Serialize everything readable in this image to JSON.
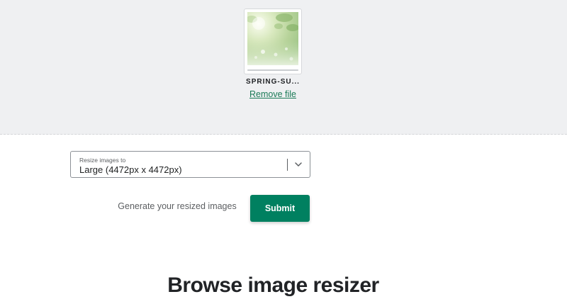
{
  "upload": {
    "file_name": "SPRING-SU...",
    "remove_label": "Remove file",
    "thumbnail_icon": "spring-nature-thumbnail",
    "progress": 1.0
  },
  "resize_select": {
    "label": "Resize images to",
    "selected_value": "Large (4472px x 4472px)",
    "chevron_icon": "chevron-down-icon"
  },
  "action": {
    "helper_text": "Generate your resized images",
    "submit_label": "Submit"
  },
  "section": {
    "heading": "Browse image resizer"
  },
  "colors": {
    "accent": "#008060",
    "link": "#1b7a57",
    "upload_bg": "#eff0f2"
  }
}
